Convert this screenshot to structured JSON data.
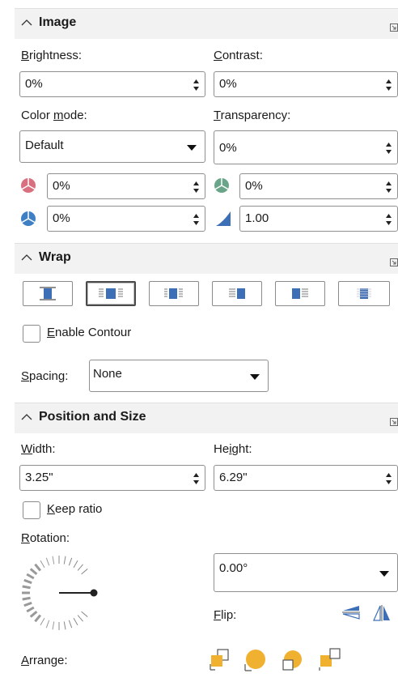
{
  "image_section": {
    "title": "Image",
    "brightness_label_u": "B",
    "brightness_label_rest": "rightness:",
    "brightness_value": "0%",
    "contrast_label_u": "C",
    "contrast_label_rest": "ontrast:",
    "contrast_value": "0%",
    "color_mode_label_pre": "Color ",
    "color_mode_label_u": "m",
    "color_mode_label_rest": "ode:",
    "color_mode_value": "Default",
    "transparency_label_u": "T",
    "transparency_label_rest": "ransparency:",
    "transparency_value": "0%",
    "red_value": "0%",
    "green_value": "0%",
    "blue_value": "0%",
    "gamma_value": "1.00"
  },
  "wrap_section": {
    "title": "Wrap",
    "enable_contour_u": "E",
    "enable_contour_rest": "nable Contour",
    "spacing_label_u": "S",
    "spacing_label_rest": "pacing:",
    "spacing_value": "None"
  },
  "position_section": {
    "title": "Position and Size",
    "width_label_u": "W",
    "width_label_rest": "idth:",
    "width_value": "3.25\"",
    "height_label_pre": "He",
    "height_label_u": "i",
    "height_label_rest": "ght:",
    "height_value": "6.29\"",
    "keep_ratio_u": "K",
    "keep_ratio_rest": "eep ratio",
    "rotation_label_u": "R",
    "rotation_label_rest": "otation:",
    "rotation_value": "0.00°",
    "flip_label_u": "F",
    "flip_label_rest": "lip:",
    "arrange_label_u": "A",
    "arrange_label_rest": "rrange:"
  },
  "colors": {
    "red_channel": "#d9707f",
    "green_channel": "#6aa58a",
    "blue_channel": "#3f7fc4",
    "icon_blue": "#3d6fb6",
    "arrange_orange": "#f0b030"
  }
}
